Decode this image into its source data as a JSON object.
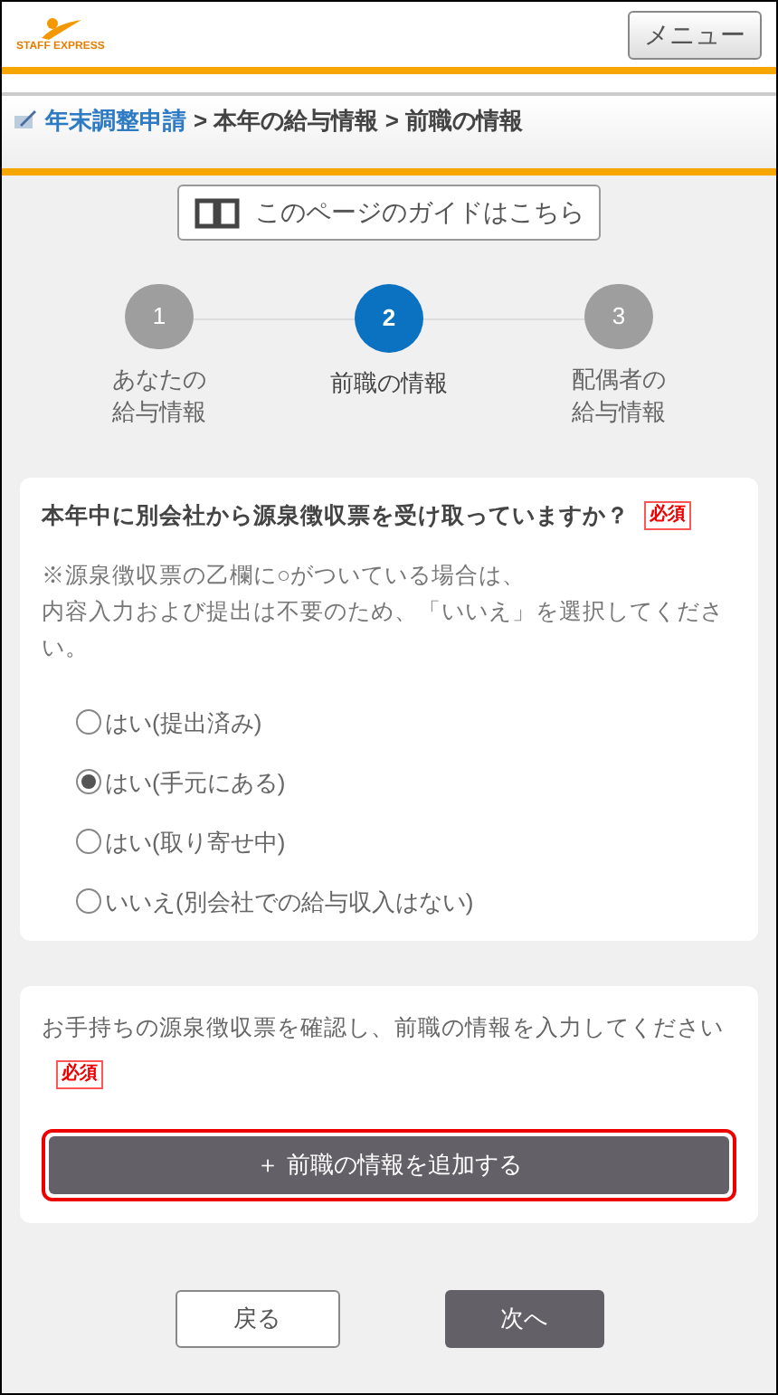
{
  "header": {
    "logo_text": "STAFF EXPRESS",
    "menu_button": "メニュー"
  },
  "breadcrumb": {
    "link": "年末調整申請",
    "rest": "> 本年の給与情報 > 前職の情報"
  },
  "guide_button": "このページのガイドはこちら",
  "steps": [
    {
      "number": "1",
      "label_lines": [
        "あなたの",
        "給与情報"
      ],
      "selected": false
    },
    {
      "number": "2",
      "label_lines": [
        "前職の情報"
      ],
      "selected": true
    },
    {
      "number": "3",
      "label_lines": [
        "配偶者の",
        "給与情報"
      ],
      "selected": false
    }
  ],
  "question": {
    "title": "本年中に別会社から源泉徴収票を受け取っていますか？",
    "required_badge": "必須",
    "note_lines": [
      "※源泉徴収票の乙欄に○がついている場合は、",
      "内容入力および提出は不要のため、「いいえ」を選択してください。"
    ],
    "options": [
      {
        "label": "はい(提出済み)",
        "selected": false
      },
      {
        "label": "はい(手元にある)",
        "selected": true
      },
      {
        "label": "はい(取り寄せ中)",
        "selected": false
      },
      {
        "label": "いいえ(別会社での給与収入はない)",
        "selected": false
      }
    ]
  },
  "previous_job": {
    "instruction": "お手持ちの源泉徴収票を確認し、前職の情報を入力してください",
    "required_badge": "必須",
    "add_button": "＋ 前職の情報を追加する",
    "highlighted": true
  },
  "footer": {
    "back_button": "戻る",
    "next_button": "次へ"
  }
}
